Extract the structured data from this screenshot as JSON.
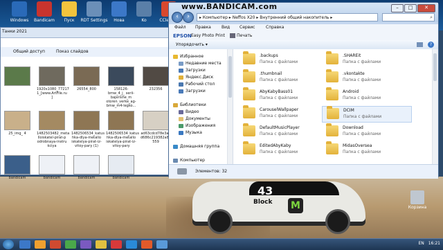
{
  "watermark": "www.BANDICAM.com",
  "desktop": {
    "icons": [
      {
        "label": "Windows",
        "color": "#2a6ab8"
      },
      {
        "label": "Bandicam",
        "color": "#c8342e"
      },
      {
        "label": "Пуск",
        "color": "#f3c43d"
      },
      {
        "label": "RDT Settings",
        "color": "#6b8fb8"
      },
      {
        "label": "Нова",
        "color": "#3c78c8"
      },
      {
        "label": "Ko",
        "color": "#5a7fa8"
      },
      {
        "label": "CCleaner",
        "color": "#d8482e"
      }
    ],
    "trash_label": "Корзина"
  },
  "bg_window": {
    "address": "Танки 2021",
    "toolbar": [
      "Общий доступ",
      "Показ слайдов"
    ],
    "thumbs": [
      {
        "label": "",
        "color": "#5b7a4a"
      },
      {
        "label": "1920x1080_77217 1_[www.ArtFile.ru ]",
        "color": "#6f6a5e"
      },
      {
        "label": "26554_800",
        "color": "#7a6a54"
      },
      {
        "label": "158126-bmw_4_j_ serii-bajerishe_m otoren_verke_ag- bmw_m4-legko...",
        "color": "#3b4a5c"
      },
      {
        "label": "232356",
        "color": "#514a44"
      },
      {
        "label": "25_img_ 4",
        "color": "#c9b08a"
      },
      {
        "label": "1482503482_meta lloiskatel-pirat-p odrobnaya-instru kciya",
        "color": "#a48a62"
      },
      {
        "label": "1482506534_katus hka-dlya-metallo iskatelya-pirat-iz- vitoy-pary (1)",
        "color": "#8e7654"
      },
      {
        "label": "1482506534_katus hka-dlya-metallo iskatelya-pirat-iz- vitoy-pary",
        "color": "#8e7654"
      },
      {
        "label": "ad63cdcd78e3a9 d686c219382a8b9 559",
        "color": "#d7d0c4"
      },
      {
        "label": "bandicam",
        "color": "#3b5f8a"
      },
      {
        "label": "bandicam",
        "color": "#eef1f6"
      },
      {
        "label": "bandicam",
        "color": "#eef1f6"
      },
      {
        "label": "bandicam",
        "color": "#e6ebf2"
      }
    ]
  },
  "window": {
    "breadcrumb": "▸ Компьютер ▸ Neffos X20 ▸ Внутренний общий накопитель ▸",
    "menu": [
      "Файл",
      "Правка",
      "Вид",
      "Сервис",
      "Справка"
    ],
    "epson": {
      "brand": "EPSON",
      "app": "Easy Photo Print",
      "print": "Печать"
    },
    "organize": "Упорядочить ▾",
    "nav": [
      {
        "label": "Избранное",
        "icon": "star-icon",
        "color": "#e8b830"
      },
      {
        "label": "Недавние места",
        "icon": "recent-places-icon",
        "color": "#7a9cc6"
      },
      {
        "label": "Загрузки",
        "icon": "downloads-icon",
        "color": "#4a7ab8"
      },
      {
        "label": "Яндекс.Диск",
        "icon": "yandex-disk-icon",
        "color": "#e0b03a"
      },
      {
        "label": "Рабочий стол",
        "icon": "desktop-icon",
        "color": "#4a78b0"
      },
      {
        "label": "Загрузки",
        "icon": "downloads-icon",
        "color": "#4a7ab8"
      },
      {
        "label": "",
        "icon": "",
        "color": ""
      },
      {
        "label": "Библиотеки",
        "icon": "libraries-icon",
        "color": "#d9a93a"
      },
      {
        "label": "Видео",
        "icon": "video-icon",
        "color": "#6a6a9a"
      },
      {
        "label": "Документы",
        "icon": "documents-icon",
        "color": "#e2c070"
      },
      {
        "label": "Изображения",
        "icon": "pictures-icon",
        "color": "#4a9a6a"
      },
      {
        "label": "Музыка",
        "icon": "music-icon",
        "color": "#3a78c0"
      },
      {
        "label": "",
        "icon": "",
        "color": ""
      },
      {
        "label": "Домашняя группа",
        "icon": "homegroup-icon",
        "color": "#3a8ac8"
      },
      {
        "label": "",
        "icon": "",
        "color": ""
      },
      {
        "label": "Компьютер",
        "icon": "computer-icon",
        "color": "#6a8ab0"
      }
    ],
    "folders": [
      {
        "name": ".backups",
        "type": "Папка с файлами"
      },
      {
        "name": ".SHAREit",
        "type": "Папка с файлами"
      },
      {
        "name": ".thumbnail",
        "type": "Папка с файлами"
      },
      {
        "name": ".vkontakte",
        "type": "Папка с файлами"
      },
      {
        "name": "AbyKabyBass01",
        "type": "Папка с файлами"
      },
      {
        "name": "Android",
        "type": "Папка с файлами"
      },
      {
        "name": "CarouselWallpaper",
        "type": "Папка с файлами"
      },
      {
        "name": "DCIM",
        "type": "Папка с файлами"
      },
      {
        "name": "DefaultMusicPlayer",
        "type": "Папка с файлами"
      },
      {
        "name": "Download",
        "type": "Папка с файлами"
      },
      {
        "name": "EditedAbyKaby",
        "type": "Папка с файлами"
      },
      {
        "name": "MidasOversea",
        "type": "Папка с файлами"
      }
    ],
    "status": "Элементов: 32"
  },
  "wallpaper": {
    "car_number": "43",
    "sponsor": "Block"
  },
  "taskbar": {
    "apps": [
      "#3c78c8",
      "#f0a030",
      "#d04a30",
      "#4aa84a",
      "#7a5ac0",
      "#e0c040",
      "#d83a3a",
      "#2a8ad8",
      "#e25a2a",
      "#5a9ad8"
    ],
    "lang": "EN",
    "time": "16:21"
  }
}
